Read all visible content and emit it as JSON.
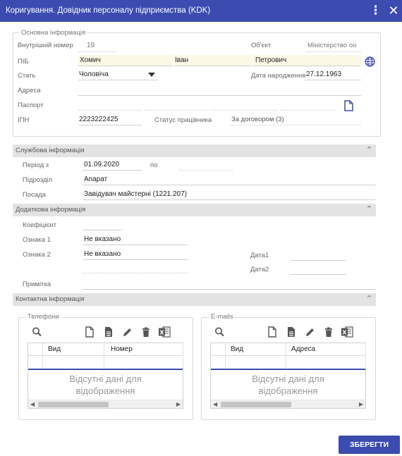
{
  "window": {
    "title": "Коригування. Довідник персоналу підприємства (KDK)",
    "kebab_glyph": "⋮",
    "close_glyph": "✕"
  },
  "main_info": {
    "legend": "Основна інформація",
    "internal_number_label": "Внутрішній номер",
    "internal_number_value": "19",
    "object_label": "Об'єкт",
    "object_value": "Міністерство оо",
    "pib_label": "ПІБ",
    "last_name": "Хомич",
    "first_name": "Іван",
    "middle_name": "Петрович",
    "gender_label": "Стать",
    "gender_value": "Чоловіча",
    "birth_date_label": "Дата народження",
    "birth_date_value": "27.12.1963",
    "address_label": "Адреса",
    "passport_label": "Паспорт",
    "ipn_label": "ІПН",
    "ipn_value": "2223222425",
    "employee_status_label": "Статус працівника",
    "employee_status_value": "За договором (3)"
  },
  "service_info": {
    "title": "Службова інформація",
    "period_from_label": "Період з",
    "period_from_value": "01.09.2020",
    "period_to_label": "по",
    "department_label": "Підрозділ",
    "department_value": "Апарат",
    "position_label": "Посада",
    "position_value": "Завідувач майстерні (1221.207)"
  },
  "additional_info": {
    "title": "Додаткова інформація",
    "coefficient_label": "Коефіцієнт",
    "sign1_label": "Ознака 1",
    "sign1_value": "Не вказано",
    "sign2_label": "Ознака 2",
    "sign2_value": "Не вказано",
    "date1_label": "Дата1",
    "date2_label": "Дата2",
    "note_label": "Примітка"
  },
  "contact_info": {
    "title": "Контактна інформація",
    "phones": {
      "legend": "Телефони",
      "col_type": "Вид",
      "col_value": "Номер",
      "empty_line1": "Відсутні дані для",
      "empty_line2": "відображення"
    },
    "emails": {
      "legend": "E-mails",
      "col_type": "Вид",
      "col_value": "Адреса",
      "empty_line1": "Відсутні дані для",
      "empty_line2": "відображення"
    }
  },
  "footer": {
    "save_label": "ЗБЕРЕГТИ"
  },
  "colors": {
    "accent": "#3b4bb0",
    "section_bg": "#e3e3e3",
    "highlight_field": "#fdf8e6"
  }
}
